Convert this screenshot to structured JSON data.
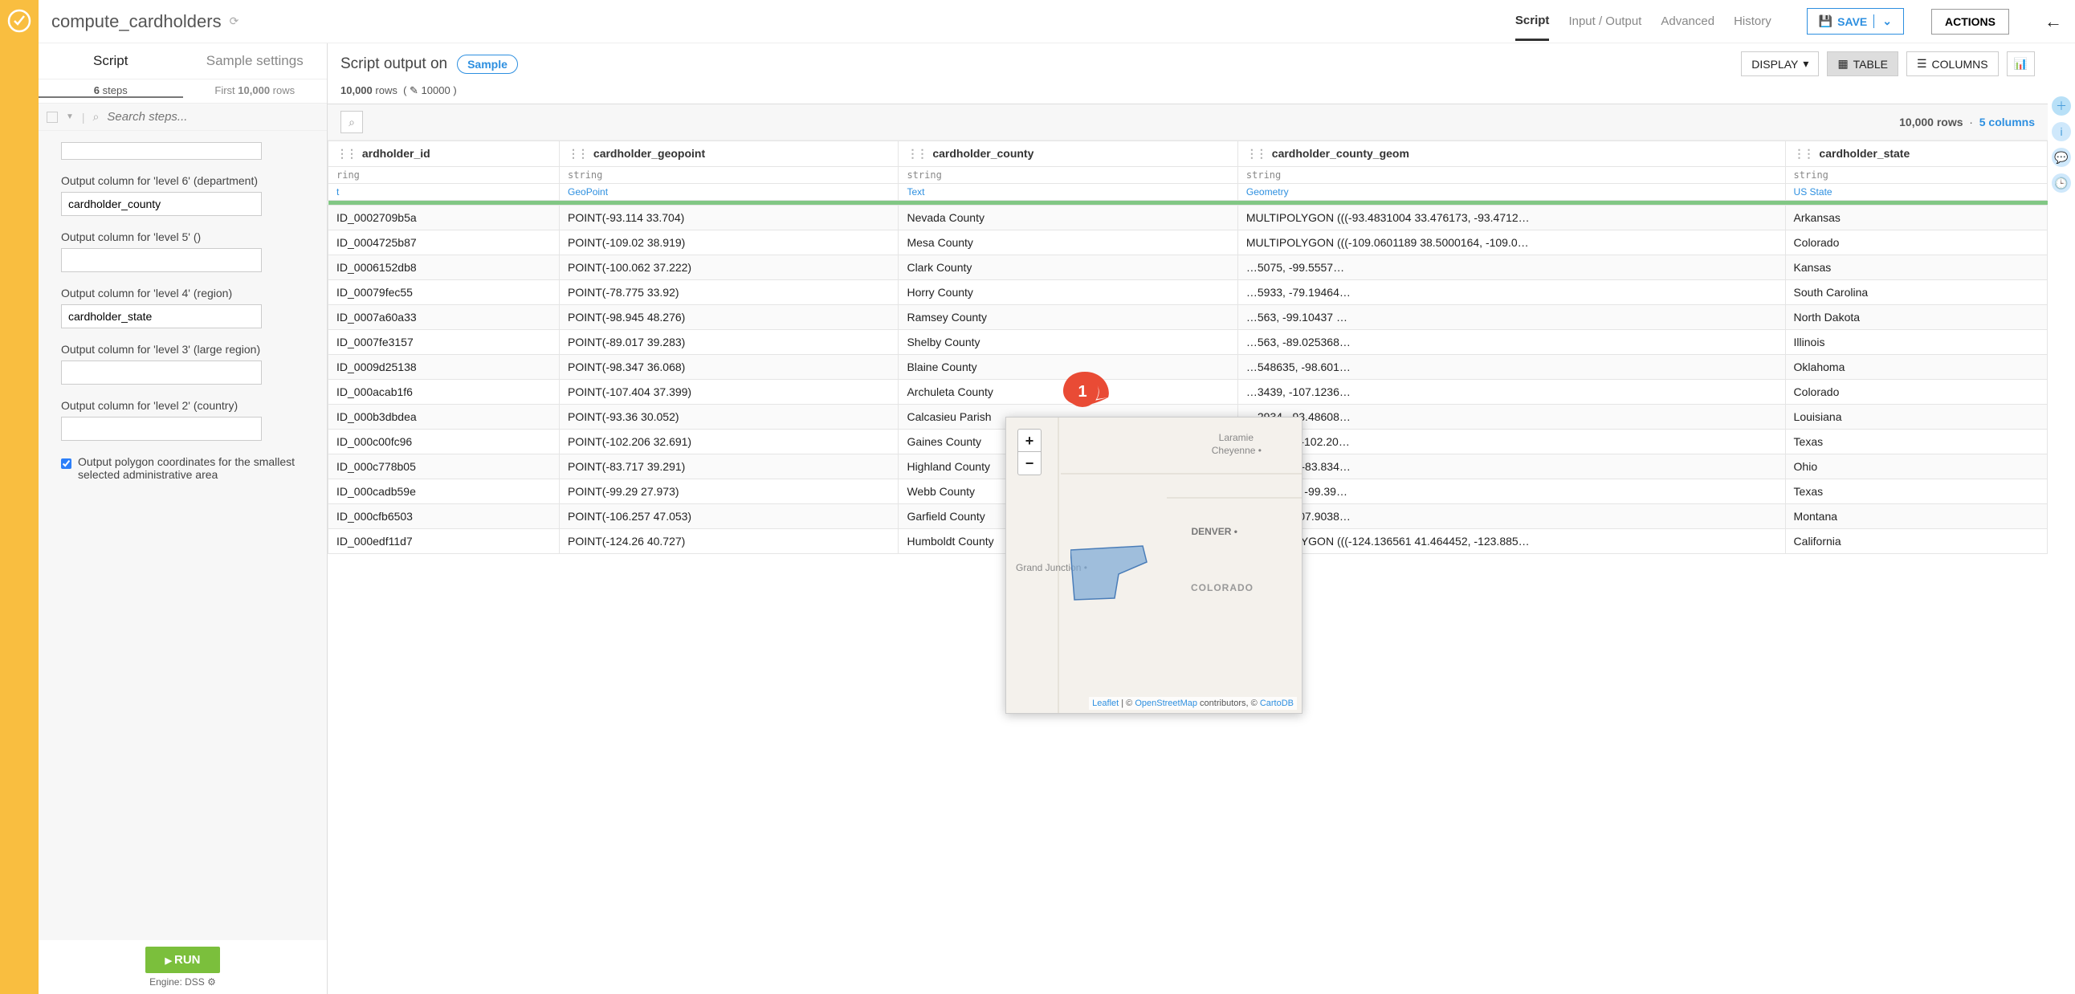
{
  "title": "compute_cardholders",
  "top_tabs": [
    "Script",
    "Input / Output",
    "Advanced",
    "History"
  ],
  "top_active": 0,
  "save_label": "SAVE",
  "actions_label": "ACTIONS",
  "left_tabs": {
    "script": "Script",
    "sample": "Sample settings"
  },
  "left_sub": {
    "steps": "6 steps",
    "steps_n": "6",
    "rows": "First 10,000 rows",
    "rows_n": "10,000"
  },
  "search_placeholder": "Search steps...",
  "fields": {
    "l6_label": "Output column for 'level 6' (department)",
    "l6_value": "cardholder_county",
    "l5_label": "Output column for 'level 5' ()",
    "l5_value": "",
    "l4_label": "Output column for 'level 4' (region)",
    "l4_value": "cardholder_state",
    "l3_label": "Output column for 'level 3' (large region)",
    "l3_value": "",
    "l2_label": "Output column for 'level 2' (country)",
    "l2_value": ""
  },
  "poly_check": "Output polygon coordinates for the smallest selected administrative area",
  "run_label": "RUN",
  "engine_label": "Engine: DSS",
  "out_header": {
    "prefix": "Script output on",
    "sample": "Sample"
  },
  "out_sub": {
    "rows": "10,000",
    "rows_label": "rows",
    "pencil_n": "10000"
  },
  "display_label": "DISPLAY",
  "table_label": "TABLE",
  "cols_label": "COLUMNS",
  "stats": {
    "rows": "10,000 rows",
    "sep": "·",
    "cols": "5 columns"
  },
  "columns": [
    {
      "name": "ardholder_id",
      "type": "ring",
      "sem": "t"
    },
    {
      "name": "cardholder_geopoint",
      "type": "string",
      "sem": "GeoPoint"
    },
    {
      "name": "cardholder_county",
      "type": "string",
      "sem": "Text"
    },
    {
      "name": "cardholder_county_geom",
      "type": "string",
      "sem": "Geometry"
    },
    {
      "name": "cardholder_state",
      "type": "string",
      "sem": "US State"
    }
  ],
  "rows": [
    [
      "ID_0002709b5a",
      "POINT(-93.114 33.704)",
      "Nevada County",
      "MULTIPOLYGON (((-93.4831004 33.476173, -93.4712…",
      "Arkansas"
    ],
    [
      "ID_0004725b87",
      "POINT(-109.02 38.919)",
      "Mesa County",
      "MULTIPOLYGON (((-109.0601189 38.5000164, -109.0…",
      "Colorado"
    ],
    [
      "ID_0006152db8",
      "POINT(-100.062 37.222)",
      "Clark County",
      "…5075, -99.5557…",
      "Kansas"
    ],
    [
      "ID_00079fec55",
      "POINT(-78.775 33.92)",
      "Horry County",
      "…5933, -79.19464…",
      "South Carolina"
    ],
    [
      "ID_0007a60a33",
      "POINT(-98.945 48.276)",
      "Ramsey County",
      "…563, -99.10437 …",
      "North Dakota"
    ],
    [
      "ID_0007fe3157",
      "POINT(-89.017 39.283)",
      "Shelby County",
      "…563, -89.025368…",
      "Illinois"
    ],
    [
      "ID_0009d25138",
      "POINT(-98.347 36.068)",
      "Blaine County",
      "…548635, -98.601…",
      "Oklahoma"
    ],
    [
      "ID_000acab1f6",
      "POINT(-107.404 37.399)",
      "Archuleta County",
      "…3439, -107.1236…",
      "Colorado"
    ],
    [
      "ID_000b3dbdea",
      "POINT(-93.36 30.052)",
      "Calcasieu Parish",
      "…2934, -93.48608…",
      "Louisiana"
    ],
    [
      "ID_000c00fc96",
      "POINT(-102.206 32.691)",
      "Gaines County",
      "…591132, -102.20…",
      "Texas"
    ],
    [
      "ID_000c778b05",
      "POINT(-83.717 39.291)",
      "Highland County",
      "…373715, -83.834…",
      "Ohio"
    ],
    [
      "ID_000cadb59e",
      "POINT(-99.29 27.973)",
      "Webb County",
      "….968144, -99.39…",
      "Texas"
    ],
    [
      "ID_000cfb6503",
      "POINT(-106.257 47.053)",
      "Garfield County",
      "…0018, -107.9038…",
      "Montana"
    ],
    [
      "ID_000edf11d7",
      "POINT(-124.26 40.727)",
      "Humboldt County",
      "MULTIPOLYGON (((-124.136561 41.464452, -123.885…",
      "California"
    ]
  ],
  "marker_text": "1",
  "map": {
    "labels": {
      "laramie": "Laramie",
      "cheyenne": "Cheyenne",
      "denver": "DENVER",
      "gj": "Grand Junction",
      "co": "COLORADO"
    },
    "attrib": {
      "leaflet": "Leaflet",
      "osm": "OpenStreetMap",
      "contrib": " contributors, © ",
      "cartodb": "CartoDB"
    }
  }
}
